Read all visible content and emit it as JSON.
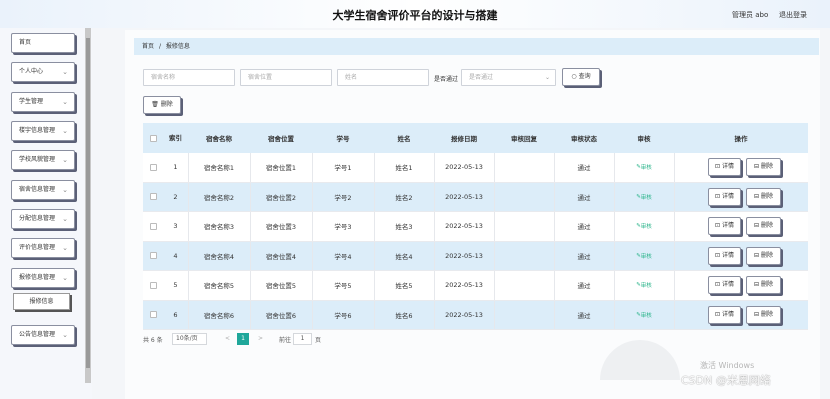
{
  "header": {
    "title": "大学生宿舍评价平台的设计与搭建",
    "admin": "管理员 abo",
    "logout": "退出登录"
  },
  "sidebar": {
    "items": [
      {
        "label": "首页",
        "chev": false
      },
      {
        "label": "个人中心",
        "chev": true
      },
      {
        "label": "学生管理",
        "chev": true
      },
      {
        "label": "楼宇信息管理",
        "chev": true
      },
      {
        "label": "学校风貌管理",
        "chev": true
      },
      {
        "label": "宿舍信息管理",
        "chev": true
      },
      {
        "label": "分配信息管理",
        "chev": true
      },
      {
        "label": "评价信息管理",
        "chev": true
      },
      {
        "label": "报修信息管理",
        "chev": true
      },
      {
        "label": "公告信息管理",
        "chev": true
      }
    ],
    "submenu": "报修信息"
  },
  "breadcrumb": {
    "home": "首页",
    "sep": "/",
    "current": "报修信息"
  },
  "filters": {
    "dorm_name_ph": "宿舍名称",
    "dorm_loc_ph": "宿舍位置",
    "name_ph": "姓名",
    "pass_label": "是否通过",
    "pass_ph": "是否通过",
    "query": "查询",
    "delete": "删除"
  },
  "table": {
    "headers": [
      "索引",
      "宿舍名称",
      "宿舍位置",
      "学号",
      "姓名",
      "报修日期",
      "审核回复",
      "审核状态",
      "审核",
      "操作"
    ],
    "audit_link": "审核",
    "detail": "详情",
    "del": "删除",
    "rows": [
      {
        "idx": "1",
        "name": "宿舍名称1",
        "loc": "宿舍位置1",
        "sid": "学号1",
        "sname": "姓名1",
        "date": "2022-05-13",
        "reply": "",
        "status": "通过"
      },
      {
        "idx": "2",
        "name": "宿舍名称2",
        "loc": "宿舍位置2",
        "sid": "学号2",
        "sname": "姓名2",
        "date": "2022-05-13",
        "reply": "",
        "status": "通过"
      },
      {
        "idx": "3",
        "name": "宿舍名称3",
        "loc": "宿舍位置3",
        "sid": "学号3",
        "sname": "姓名3",
        "date": "2022-05-13",
        "reply": "",
        "status": "通过"
      },
      {
        "idx": "4",
        "name": "宿舍名称4",
        "loc": "宿舍位置4",
        "sid": "学号4",
        "sname": "姓名4",
        "date": "2022-05-13",
        "reply": "",
        "status": "通过"
      },
      {
        "idx": "5",
        "name": "宿舍名称5",
        "loc": "宿舍位置5",
        "sid": "学号5",
        "sname": "姓名5",
        "date": "2022-05-13",
        "reply": "",
        "status": "通过"
      },
      {
        "idx": "6",
        "name": "宿舍名称6",
        "loc": "宿舍位置6",
        "sid": "学号6",
        "sname": "姓名6",
        "date": "2022-05-13",
        "reply": "",
        "status": "通过"
      }
    ]
  },
  "pager": {
    "total": "共 6 条",
    "size": "10条/页",
    "prev": "<",
    "page": "1",
    "next": ">",
    "goto": "前往",
    "goto_val": "1",
    "unit": "页"
  },
  "watermark": {
    "activate": "激活 Windows",
    "csdn": "CSDN @米恩网络"
  },
  "colors": {
    "accent": "#1fa79a",
    "row_alt": "#dcedf9",
    "ok": "#2ab48a"
  }
}
